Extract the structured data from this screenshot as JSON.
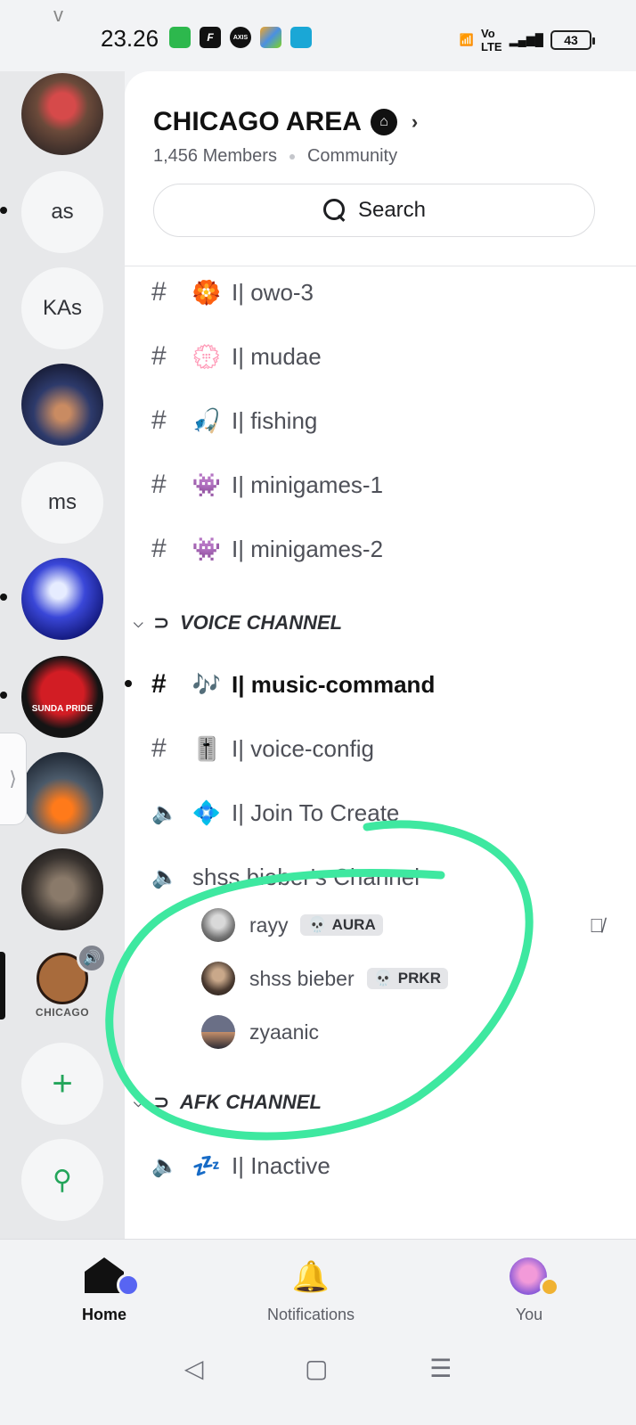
{
  "status_bar": {
    "time": "23.26",
    "battery": "43",
    "apps": [
      "app-green",
      "F",
      "AXIS",
      "app-dots",
      "app-cart"
    ]
  },
  "server_rail": {
    "text_servers": [
      "as",
      "KAs",
      "ms"
    ],
    "chicago_label": "CHICAGO",
    "sunda_label": "SUNDA PRIDE"
  },
  "server": {
    "name": "CHICAGO AREA",
    "members": "1,456 Members",
    "type": "Community",
    "search_label": "Search"
  },
  "channels": [
    {
      "kind": "text",
      "emoji": "🏵️",
      "label": "I| owo-3"
    },
    {
      "kind": "text",
      "emoji": "💮",
      "label": "I| mudae"
    },
    {
      "kind": "text",
      "emoji": "🎣",
      "label": "I| fishing"
    },
    {
      "kind": "text",
      "emoji": "👾",
      "label": "I| minigames-1"
    },
    {
      "kind": "text",
      "emoji": "👾",
      "label": "I| minigames-2"
    }
  ],
  "voice_category": {
    "label": "VOICE CHANNEL",
    "channels": [
      {
        "kind": "text",
        "emoji": "🎶",
        "label": "I| music-command",
        "unread": true
      },
      {
        "kind": "text",
        "emoji": "🎚️",
        "label": "I| voice-config"
      },
      {
        "kind": "voice",
        "emoji": "💠",
        "label": "I| Join To Create"
      },
      {
        "kind": "voice",
        "emoji": "",
        "label": "shss bieber's Channel"
      }
    ],
    "members": [
      {
        "name": "rayy",
        "tag": "AURA",
        "muted": true
      },
      {
        "name": "shss bieber",
        "tag": "PRKR",
        "muted": false
      },
      {
        "name": "zyaanic",
        "tag": "",
        "muted": false
      }
    ]
  },
  "afk_category": {
    "label": "AFK CHANNEL",
    "channels": [
      {
        "kind": "voice",
        "emoji": "💤",
        "label": "I| Inactive"
      }
    ]
  },
  "bottom_nav": {
    "home": "Home",
    "notifications": "Notifications",
    "you": "You"
  },
  "colors": {
    "accent": "#5865f2",
    "online_green": "#23a55a",
    "annotation": "#3ee8a0"
  }
}
